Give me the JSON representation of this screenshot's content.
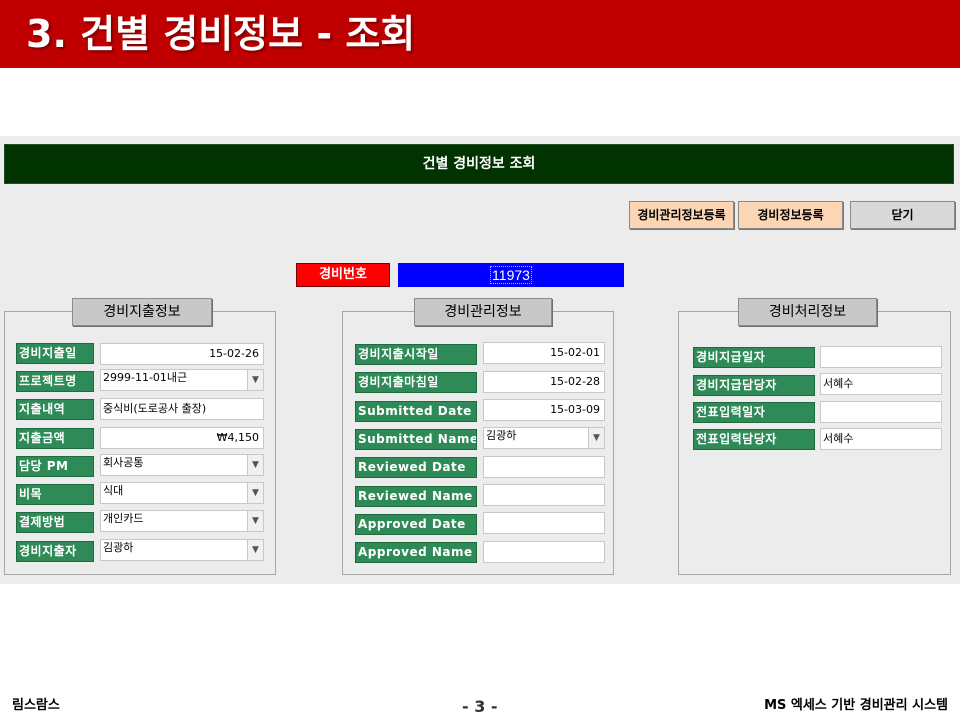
{
  "slide": {
    "title": "3. 건별 경비정보 - 조회",
    "footer_left": "림스람스",
    "page_number": "- 3 -",
    "footer_right": "MS 엑세스 기반 경비관리 시스템"
  },
  "form": {
    "title": "건별 경비정보 조회",
    "buttons": {
      "register_mgmt": "경비관리정보등록",
      "register_info": "경비정보등록",
      "close": "닫기"
    },
    "expense_no": {
      "label": "경비번호",
      "value": "11973"
    },
    "groups": {
      "spending": {
        "title": "경비지출정보",
        "fields": [
          {
            "label": "경비지출일",
            "value": "15-02-26"
          },
          {
            "label": "프로젝트명",
            "value": "2999-11-01내근"
          },
          {
            "label": "지출내역",
            "value": "중식비(도로공사 출장)"
          },
          {
            "label": "지출금액",
            "value": "₩4,150"
          },
          {
            "label": "담당 PM",
            "value": "회사공통"
          },
          {
            "label": "비목",
            "value": "식대"
          },
          {
            "label": "결제방법",
            "value": "개인카드"
          },
          {
            "label": "경비지출자",
            "value": "김광하"
          }
        ]
      },
      "management": {
        "title": "경비관리정보",
        "fields": [
          {
            "label": "경비지출시작일",
            "value": "15-02-01"
          },
          {
            "label": "경비지출마침일",
            "value": "15-02-28"
          },
          {
            "label": "Submitted Date",
            "value": "15-03-09"
          },
          {
            "label": "Submitted Name",
            "value": "김광하"
          },
          {
            "label": "Reviewed Date",
            "value": ""
          },
          {
            "label": "Reviewed Name",
            "value": ""
          },
          {
            "label": "Approved Date",
            "value": ""
          },
          {
            "label": "Approved Name",
            "value": ""
          }
        ]
      },
      "processing": {
        "title": "경비처리정보",
        "fields": [
          {
            "label": "경비지급일자",
            "value": ""
          },
          {
            "label": "경비지급담당자",
            "value": "서혜수"
          },
          {
            "label": "전표입력일자",
            "value": ""
          },
          {
            "label": "전표입력담당자",
            "value": "서혜수"
          }
        ]
      }
    }
  },
  "icons": {
    "combo_arrow": "chevron-down-icon"
  },
  "colors": {
    "header_red": "#c00000",
    "form_titlebar": "#003300",
    "label_green": "#2e8b57",
    "expense_no_label": "#ff0000",
    "expense_no_value": "#0000ff",
    "button_peach": "#fcd5b4",
    "button_gray": "#d9d9d9"
  }
}
